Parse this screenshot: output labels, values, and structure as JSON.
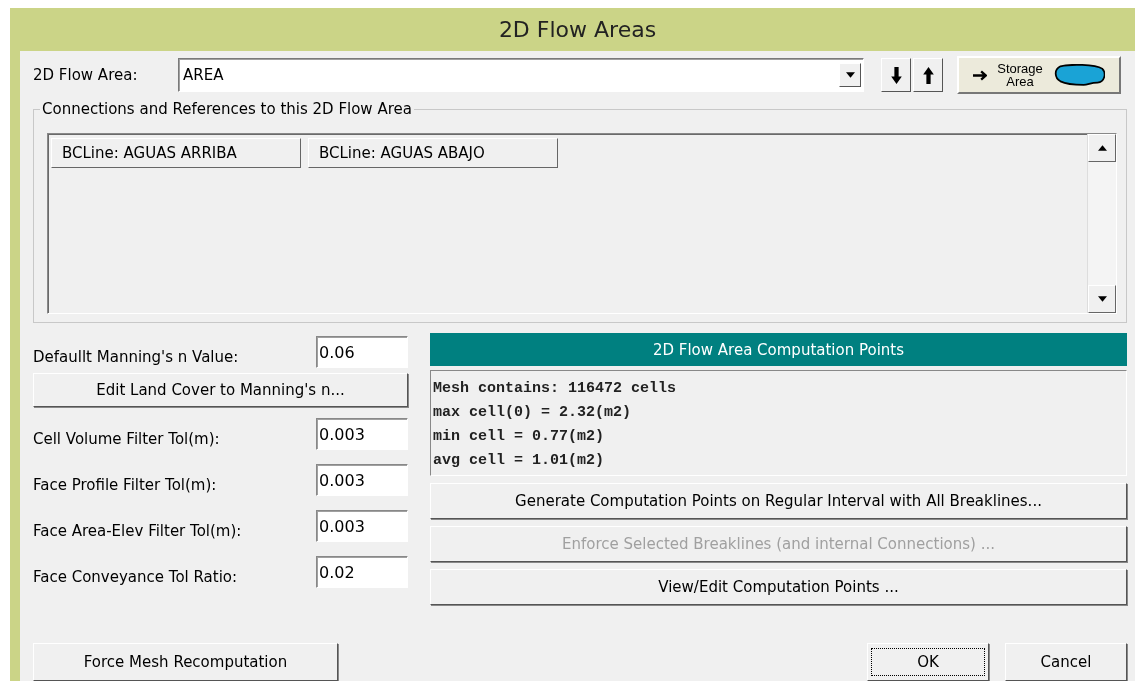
{
  "window": {
    "title": "2D Flow Areas"
  },
  "flow_area": {
    "label": "2D Flow Area:",
    "value": "AREA",
    "storage_button": "Storage Area"
  },
  "connections": {
    "legend": "Connections and References to this 2D Flow Area",
    "items": [
      {
        "label": "BCLine: AGUAS ARRIBA"
      },
      {
        "label": "BCLine: AGUAS ABAJO"
      }
    ]
  },
  "parameters": [
    {
      "kind": "field",
      "label": "Defaullt Manning's n Value:",
      "value": "0.06"
    },
    {
      "kind": "button",
      "label": "Edit Land Cover to Manning's n..."
    },
    {
      "kind": "field",
      "label": "Cell Volume Filter Tol(m):",
      "value": "0.003"
    },
    {
      "kind": "field",
      "label": "Face Profile Filter Tol(m):",
      "value": "0.003"
    },
    {
      "kind": "field",
      "label": "Face Area-Elev Filter Tol(m):",
      "value": "0.003"
    },
    {
      "kind": "field",
      "label": "Face Conveyance Tol Ratio:",
      "value": "0.02"
    }
  ],
  "computation_points": {
    "header": "2D Flow Area Computation Points",
    "info": [
      "Mesh contains: 116472 cells",
      "max cell(0) = 2.32(m2)",
      "min cell = 0.77(m2)",
      "avg cell = 1.01(m2)"
    ],
    "buttons": [
      {
        "label": "Generate Computation Points on Regular Interval with All Breaklines...",
        "disabled": false
      },
      {
        "label": "Enforce Selected Breaklines (and internal Connections) ...",
        "disabled": true
      },
      {
        "label": "View/Edit Computation Points ...",
        "disabled": false
      }
    ]
  },
  "footer": {
    "left_button": "Force Mesh Recomputation",
    "buttons": [
      {
        "label": "OK",
        "focused": true
      },
      {
        "label": "Cancel",
        "focused": false
      }
    ]
  }
}
